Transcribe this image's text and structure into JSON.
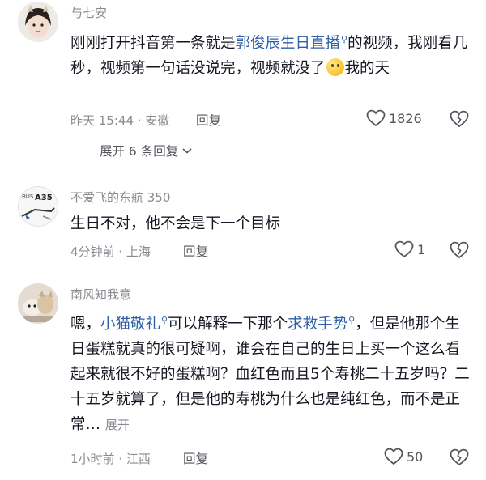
{
  "comments": [
    {
      "username": "与七安",
      "text_before": "刚刚打开抖音第一条就是",
      "link_1": "郭俊辰生日直播",
      "text_mid": "的视频，我刚看几秒，视频第一句话没说完，视频就没了",
      "text_after": "我的天",
      "meta": "昨天 15:44 · 安徽",
      "reply": "回复",
      "likes": "1826",
      "expand_replies": "展开 6 条回复"
    },
    {
      "username": "不爱飞的东航 350",
      "avatar_text": "BUS A350",
      "text": "生日不对，他不会是下一个目标",
      "meta": "4分钟前 · 上海",
      "reply": "回复",
      "likes": "1"
    },
    {
      "username": "南风知我意",
      "text_before": "嗯，",
      "link_1": "小猫敬礼",
      "text_mid": "可以解释一下那个",
      "link_2": "求救手势",
      "text_after": "，但是他那个生日蛋糕就真的很可疑啊，谁会在自己的生日上买一个这么看起来就很不好的蛋糕啊？血红色而且5个寿桃二十五岁吗？二十五岁就算了，但是他的寿桃为什么也是纯红色，而不是正常…",
      "expand_inline": "展开",
      "meta": "1小时前 · 江西",
      "reply": "回复",
      "likes": "50"
    }
  ],
  "colors": {
    "link": "#2f5fa7",
    "meta": "#8a8b91",
    "text": "#161823"
  },
  "icons": [
    "heart-icon",
    "broken-heart-icon",
    "search-icon",
    "chevron-down-icon",
    "smile-emoji-icon"
  ]
}
